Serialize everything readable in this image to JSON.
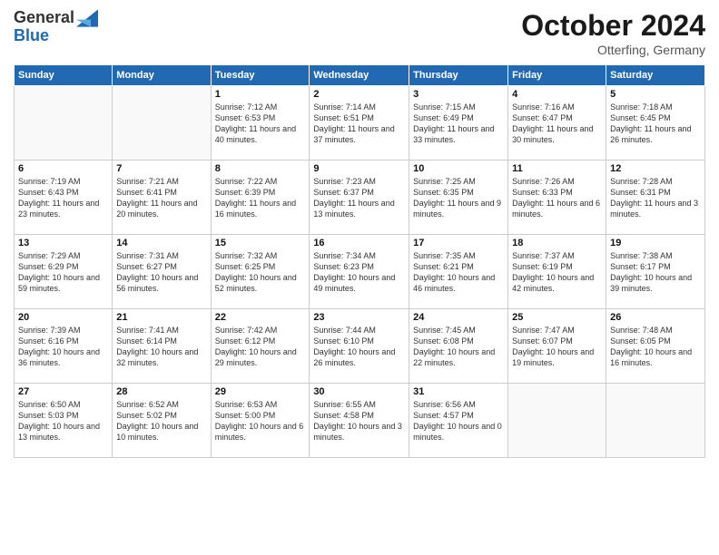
{
  "header": {
    "logo_line1": "General",
    "logo_line2": "Blue",
    "month": "October 2024",
    "location": "Otterfing, Germany"
  },
  "days_of_week": [
    "Sunday",
    "Monday",
    "Tuesday",
    "Wednesday",
    "Thursday",
    "Friday",
    "Saturday"
  ],
  "weeks": [
    [
      {
        "day": "",
        "info": ""
      },
      {
        "day": "",
        "info": ""
      },
      {
        "day": "1",
        "info": "Sunrise: 7:12 AM\nSunset: 6:53 PM\nDaylight: 11 hours and 40 minutes."
      },
      {
        "day": "2",
        "info": "Sunrise: 7:14 AM\nSunset: 6:51 PM\nDaylight: 11 hours and 37 minutes."
      },
      {
        "day": "3",
        "info": "Sunrise: 7:15 AM\nSunset: 6:49 PM\nDaylight: 11 hours and 33 minutes."
      },
      {
        "day": "4",
        "info": "Sunrise: 7:16 AM\nSunset: 6:47 PM\nDaylight: 11 hours and 30 minutes."
      },
      {
        "day": "5",
        "info": "Sunrise: 7:18 AM\nSunset: 6:45 PM\nDaylight: 11 hours and 26 minutes."
      }
    ],
    [
      {
        "day": "6",
        "info": "Sunrise: 7:19 AM\nSunset: 6:43 PM\nDaylight: 11 hours and 23 minutes."
      },
      {
        "day": "7",
        "info": "Sunrise: 7:21 AM\nSunset: 6:41 PM\nDaylight: 11 hours and 20 minutes."
      },
      {
        "day": "8",
        "info": "Sunrise: 7:22 AM\nSunset: 6:39 PM\nDaylight: 11 hours and 16 minutes."
      },
      {
        "day": "9",
        "info": "Sunrise: 7:23 AM\nSunset: 6:37 PM\nDaylight: 11 hours and 13 minutes."
      },
      {
        "day": "10",
        "info": "Sunrise: 7:25 AM\nSunset: 6:35 PM\nDaylight: 11 hours and 9 minutes."
      },
      {
        "day": "11",
        "info": "Sunrise: 7:26 AM\nSunset: 6:33 PM\nDaylight: 11 hours and 6 minutes."
      },
      {
        "day": "12",
        "info": "Sunrise: 7:28 AM\nSunset: 6:31 PM\nDaylight: 11 hours and 3 minutes."
      }
    ],
    [
      {
        "day": "13",
        "info": "Sunrise: 7:29 AM\nSunset: 6:29 PM\nDaylight: 10 hours and 59 minutes."
      },
      {
        "day": "14",
        "info": "Sunrise: 7:31 AM\nSunset: 6:27 PM\nDaylight: 10 hours and 56 minutes."
      },
      {
        "day": "15",
        "info": "Sunrise: 7:32 AM\nSunset: 6:25 PM\nDaylight: 10 hours and 52 minutes."
      },
      {
        "day": "16",
        "info": "Sunrise: 7:34 AM\nSunset: 6:23 PM\nDaylight: 10 hours and 49 minutes."
      },
      {
        "day": "17",
        "info": "Sunrise: 7:35 AM\nSunset: 6:21 PM\nDaylight: 10 hours and 46 minutes."
      },
      {
        "day": "18",
        "info": "Sunrise: 7:37 AM\nSunset: 6:19 PM\nDaylight: 10 hours and 42 minutes."
      },
      {
        "day": "19",
        "info": "Sunrise: 7:38 AM\nSunset: 6:17 PM\nDaylight: 10 hours and 39 minutes."
      }
    ],
    [
      {
        "day": "20",
        "info": "Sunrise: 7:39 AM\nSunset: 6:16 PM\nDaylight: 10 hours and 36 minutes."
      },
      {
        "day": "21",
        "info": "Sunrise: 7:41 AM\nSunset: 6:14 PM\nDaylight: 10 hours and 32 minutes."
      },
      {
        "day": "22",
        "info": "Sunrise: 7:42 AM\nSunset: 6:12 PM\nDaylight: 10 hours and 29 minutes."
      },
      {
        "day": "23",
        "info": "Sunrise: 7:44 AM\nSunset: 6:10 PM\nDaylight: 10 hours and 26 minutes."
      },
      {
        "day": "24",
        "info": "Sunrise: 7:45 AM\nSunset: 6:08 PM\nDaylight: 10 hours and 22 minutes."
      },
      {
        "day": "25",
        "info": "Sunrise: 7:47 AM\nSunset: 6:07 PM\nDaylight: 10 hours and 19 minutes."
      },
      {
        "day": "26",
        "info": "Sunrise: 7:48 AM\nSunset: 6:05 PM\nDaylight: 10 hours and 16 minutes."
      }
    ],
    [
      {
        "day": "27",
        "info": "Sunrise: 6:50 AM\nSunset: 5:03 PM\nDaylight: 10 hours and 13 minutes."
      },
      {
        "day": "28",
        "info": "Sunrise: 6:52 AM\nSunset: 5:02 PM\nDaylight: 10 hours and 10 minutes."
      },
      {
        "day": "29",
        "info": "Sunrise: 6:53 AM\nSunset: 5:00 PM\nDaylight: 10 hours and 6 minutes."
      },
      {
        "day": "30",
        "info": "Sunrise: 6:55 AM\nSunset: 4:58 PM\nDaylight: 10 hours and 3 minutes."
      },
      {
        "day": "31",
        "info": "Sunrise: 6:56 AM\nSunset: 4:57 PM\nDaylight: 10 hours and 0 minutes."
      },
      {
        "day": "",
        "info": ""
      },
      {
        "day": "",
        "info": ""
      }
    ]
  ]
}
